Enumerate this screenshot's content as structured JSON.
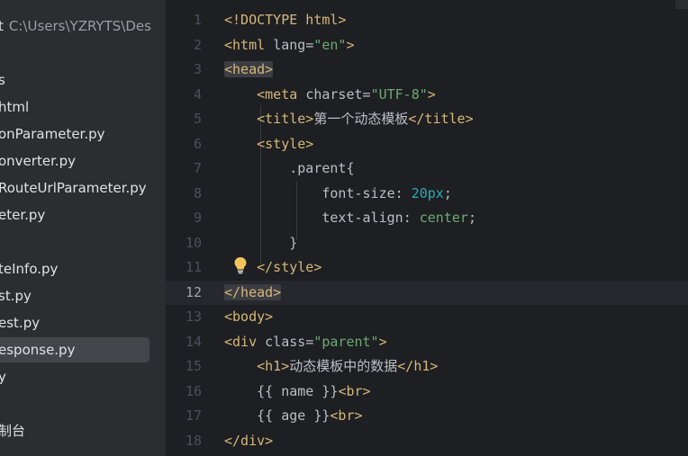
{
  "sidebar": {
    "project_name": "t",
    "project_path": "C:\\Users\\YZRYTS\\Des",
    "items": [
      {
        "label": "s"
      },
      {
        "label": "html"
      },
      {
        "label": "onParameter.py"
      },
      {
        "label": "onverter.py"
      },
      {
        "label": "RouteUrlParameter.py"
      },
      {
        "label": "eter.py"
      },
      {
        "label": ""
      },
      {
        "label": "teInfo.py"
      },
      {
        "label": "st.py"
      },
      {
        "label": "est.py"
      },
      {
        "label": "esponse.py",
        "selected": true
      },
      {
        "label": "y"
      },
      {
        "label": ""
      },
      {
        "label": "制台"
      }
    ]
  },
  "editor": {
    "current_line": "12",
    "lines": [
      {
        "n": "1",
        "parts": [
          {
            "t": "<!DOCTYPE html>",
            "c": "tag"
          }
        ]
      },
      {
        "n": "2",
        "parts": [
          {
            "t": "<html ",
            "c": "tag"
          },
          {
            "t": "lang",
            "c": "attr"
          },
          {
            "t": "=",
            "c": "attr"
          },
          {
            "t": "\"en\"",
            "c": "str"
          },
          {
            "t": ">",
            "c": "tag"
          }
        ]
      },
      {
        "n": "3",
        "parts": [
          {
            "t": "<head>",
            "c": "tag hl-tag"
          }
        ]
      },
      {
        "n": "4",
        "parts": [
          {
            "t": "    ",
            "c": "txt"
          },
          {
            "t": "<meta ",
            "c": "tag"
          },
          {
            "t": "charset",
            "c": "attr"
          },
          {
            "t": "=",
            "c": "attr"
          },
          {
            "t": "\"UTF-8\"",
            "c": "str"
          },
          {
            "t": ">",
            "c": "tag"
          }
        ]
      },
      {
        "n": "5",
        "parts": [
          {
            "t": "    ",
            "c": "txt"
          },
          {
            "t": "<title>",
            "c": "tag"
          },
          {
            "t": "第一个动态模板",
            "c": "txt"
          },
          {
            "t": "</title>",
            "c": "tag"
          }
        ]
      },
      {
        "n": "6",
        "parts": [
          {
            "t": "    ",
            "c": "txt"
          },
          {
            "t": "<style>",
            "c": "tag"
          }
        ]
      },
      {
        "n": "7",
        "parts": [
          {
            "t": "        ",
            "c": "txt"
          },
          {
            "t": ".parent{",
            "c": "cls"
          }
        ]
      },
      {
        "n": "8",
        "parts": [
          {
            "t": "            ",
            "c": "txt"
          },
          {
            "t": "font-size",
            "c": "attr"
          },
          {
            "t": ": ",
            "c": "txt"
          },
          {
            "t": "20px",
            "c": "num"
          },
          {
            "t": ";",
            "c": "txt"
          }
        ]
      },
      {
        "n": "9",
        "parts": [
          {
            "t": "            ",
            "c": "txt"
          },
          {
            "t": "text-align",
            "c": "attr"
          },
          {
            "t": ": ",
            "c": "txt"
          },
          {
            "t": "center",
            "c": "str"
          },
          {
            "t": ";",
            "c": "txt"
          }
        ]
      },
      {
        "n": "10",
        "parts": [
          {
            "t": "        ",
            "c": "txt"
          },
          {
            "t": "}",
            "c": "txt"
          }
        ]
      },
      {
        "n": "11",
        "parts": [
          {
            "t": "    ",
            "c": "txt"
          },
          {
            "t": "</style>",
            "c": "tag"
          }
        ]
      },
      {
        "n": "12",
        "parts": [
          {
            "t": "</head>",
            "c": "tag hl-tag"
          }
        ]
      },
      {
        "n": "13",
        "parts": [
          {
            "t": "<body>",
            "c": "tag"
          }
        ]
      },
      {
        "n": "14",
        "parts": [
          {
            "t": "<div ",
            "c": "tag"
          },
          {
            "t": "class",
            "c": "attr"
          },
          {
            "t": "=",
            "c": "attr"
          },
          {
            "t": "\"parent\"",
            "c": "str"
          },
          {
            "t": ">",
            "c": "tag"
          }
        ]
      },
      {
        "n": "15",
        "parts": [
          {
            "t": "    ",
            "c": "txt"
          },
          {
            "t": "<h1>",
            "c": "tag"
          },
          {
            "t": "动态模板中的数据",
            "c": "txt"
          },
          {
            "t": "</h1>",
            "c": "tag"
          }
        ]
      },
      {
        "n": "16",
        "parts": [
          {
            "t": "    ",
            "c": "txt"
          },
          {
            "t": "{{ name }}",
            "c": "txt"
          },
          {
            "t": "<br>",
            "c": "tag"
          }
        ]
      },
      {
        "n": "17",
        "parts": [
          {
            "t": "    ",
            "c": "txt"
          },
          {
            "t": "{{ age }}",
            "c": "txt"
          },
          {
            "t": "<br>",
            "c": "tag"
          }
        ]
      },
      {
        "n": "18",
        "parts": [
          {
            "t": "</div>",
            "c": "tag"
          }
        ]
      }
    ],
    "gutter_icon": "lightbulb-icon"
  },
  "colors": {
    "tag": "#d5b778",
    "string": "#6aab73",
    "number": "#2aacb8",
    "text": "#bcbec4",
    "background": "#1e1f22",
    "sidebar": "#2b2d30"
  }
}
